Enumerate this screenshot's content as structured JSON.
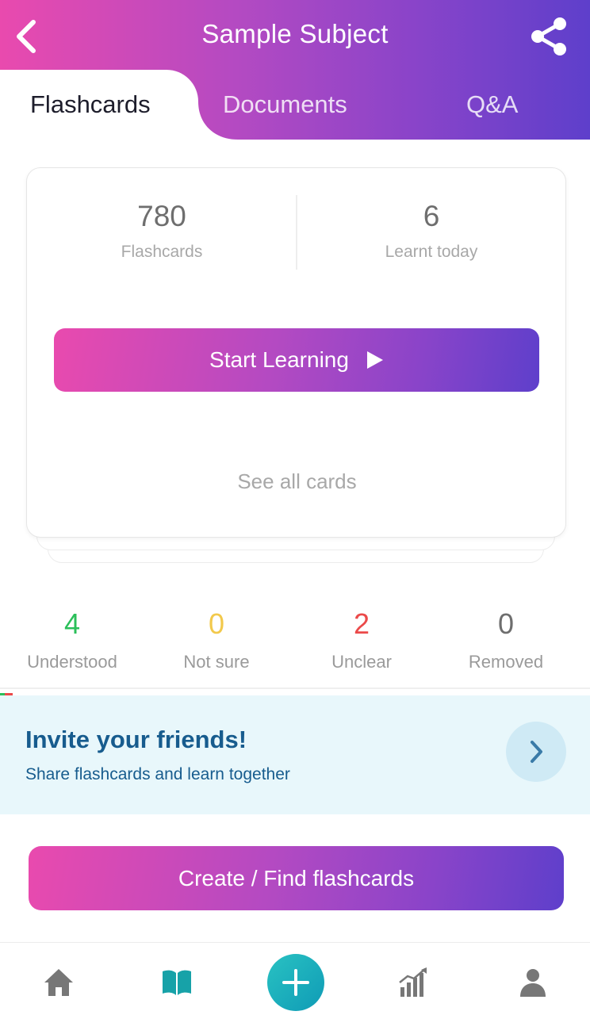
{
  "header": {
    "title": "Sample Subject",
    "back_icon": "chevron-left-icon",
    "share_icon": "share-icon",
    "gradient": [
      "#e94aae",
      "#b44ac2",
      "#8a44c9",
      "#5e3fcb"
    ]
  },
  "tabs": [
    {
      "label": "Flashcards",
      "active": true
    },
    {
      "label": "Documents",
      "active": false
    },
    {
      "label": "Q&A",
      "active": false
    }
  ],
  "stats": {
    "flashcards_count": "780",
    "flashcards_label": "Flashcards",
    "learnt_today_count": "6",
    "learnt_today_label": "Learnt today"
  },
  "start_button": {
    "label": "Start Learning",
    "icon": "play-icon"
  },
  "see_all_label": "See all cards",
  "status": [
    {
      "count": "4",
      "label": "Understood",
      "color": "#2bbf5a"
    },
    {
      "count": "0",
      "label": "Not sure",
      "color": "#f2c94c"
    },
    {
      "count": "2",
      "label": "Unclear",
      "color": "#eb4a4a"
    },
    {
      "count": "0",
      "label": "Removed",
      "color": "#6e6e6e"
    }
  ],
  "invite": {
    "title": "Invite your friends!",
    "subtitle": "Share flashcards and learn together",
    "icon": "chevron-right-icon",
    "background": "#e8f7fb",
    "text_color": "#175c8e"
  },
  "create_button": {
    "label": "Create / Find flashcards"
  },
  "bottom_nav": [
    {
      "icon": "home-icon",
      "active": false
    },
    {
      "icon": "book-icon",
      "active": true
    },
    {
      "icon": "add-icon",
      "active": false
    },
    {
      "icon": "stats-icon",
      "active": false
    },
    {
      "icon": "profile-icon",
      "active": false
    }
  ]
}
